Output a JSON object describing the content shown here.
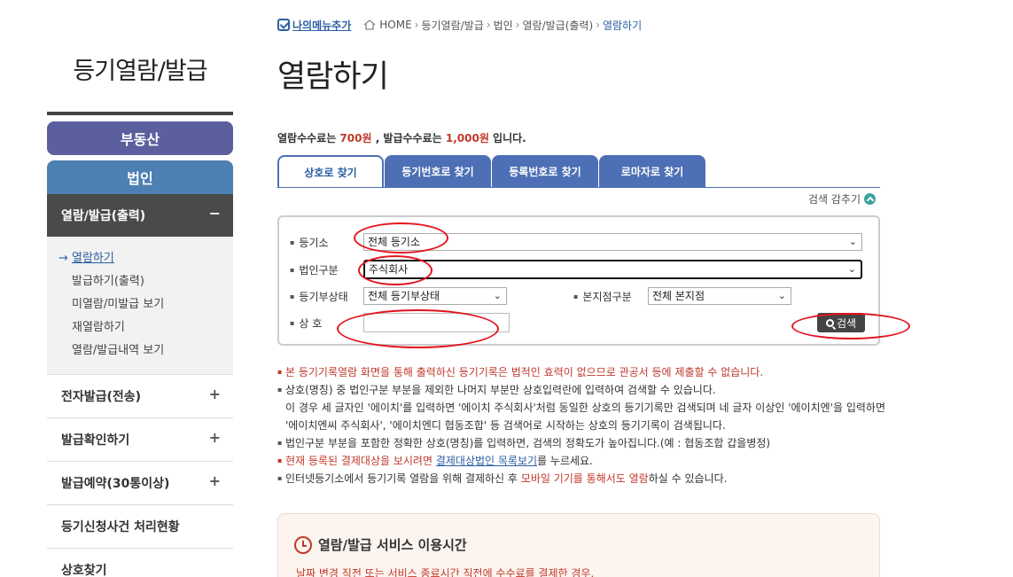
{
  "sidebar": {
    "title": "등기열람/발급",
    "categories": {
      "realestate": "부동산",
      "corporation": "법인"
    },
    "active_menu": {
      "label": "열람/발급(출력)",
      "toggle": "−"
    },
    "submenu": [
      {
        "label": "열람하기",
        "current": true
      },
      {
        "label": "발급하기(출력)"
      },
      {
        "label": "미열람/미발급 보기"
      },
      {
        "label": "재열람하기"
      },
      {
        "label": "열람/발급내역 보기"
      }
    ],
    "menus": [
      {
        "label": "전자발급(전송)",
        "toggle": "+"
      },
      {
        "label": "발급확인하기",
        "toggle": "+"
      },
      {
        "label": "발급예약(30통이상)",
        "toggle": "+"
      },
      {
        "label": "등기신청사건 처리현황"
      },
      {
        "label": "상호찾기"
      }
    ]
  },
  "breadcrumb": {
    "my_menu": "나의메뉴추가",
    "items": [
      "HOME",
      "등기열람/발급",
      "법인",
      "열람/발급(출력)",
      "열람하기"
    ],
    "separator": "›"
  },
  "page_title": "열람하기",
  "fee": {
    "prefix": "열람수수료는 ",
    "view_fee": "700원",
    "middle": " , 발급수수료는 ",
    "issue_fee": "1,000원",
    "suffix": " 입니다."
  },
  "tabs": [
    "상호로 찾기",
    "등기번호로 찾기",
    "등록번호로 찾기",
    "로마자로 찾기"
  ],
  "collapse_label": "검색 감추기",
  "search_form": {
    "registry_office_label": "등기소",
    "registry_office_value": "전체 등기소",
    "corp_type_label": "법인구분",
    "corp_type_value": "주식회사",
    "registry_status_label": "등기부상태",
    "registry_status_value": "전체 등기부상태",
    "branch_type_label": "본지점구분",
    "branch_type_value": "전체 본지점",
    "trade_name_label": "상 호",
    "trade_name_value": "",
    "search_button": "검색"
  },
  "notes": {
    "n1": "본 등기기록열람 화면을 통해 출력하신 등기기록은 법적인 효력이 없으므로 관공서 등에 제출할 수 없습니다.",
    "n2": "상호(명칭) 중 법인구분 부분을 제외한 나머지 부분만 상호입력란에 입력하여 검색할 수 있습니다.",
    "n2_cont1": "이 경우 세 글자인 '에이치'를 입력하면 '에이치 주식회사'처럼 동일한 상호의 등기기록만 검색되며 네 글자 이상인 '에이치엔'을 입력하면",
    "n2_cont2": "'에이치엔씨 주식회사', '에이치엔디 협동조합' 등 검색어로 시작하는 상호의 등기기록이 검색됩니다.",
    "n3": "법인구분 부분을 포함한 정확한 상호(명칭)를 입력하면, 검색의 정확도가 높아집니다.(예 : 협동조합 갑을병정)",
    "n4_pre": "현재 등록된 결제대상을 보시려면 ",
    "n4_link": "결제대상법인 목록보기",
    "n4_post": "를 누르세요.",
    "n5_pre": "인터넷등기소에서 등기기록 열람을 위해 결제하신 후 ",
    "n5_red": "모바일 기기를 통해서도 열람",
    "n5_post": "하실 수 있습니다."
  },
  "service": {
    "title": "열람/발급 서비스 이용시간",
    "text": "날짜 변경 직전 또는 서비스 종료시간 직전에 수수료를 결제한 경우,"
  },
  "colors": {
    "tab_blue": "#4d6fb5",
    "sidebar_purple": "#5c5f9e",
    "sidebar_blue": "#4d80b3",
    "annotation_red": "#e3141c",
    "accent_red": "#c0392b"
  }
}
